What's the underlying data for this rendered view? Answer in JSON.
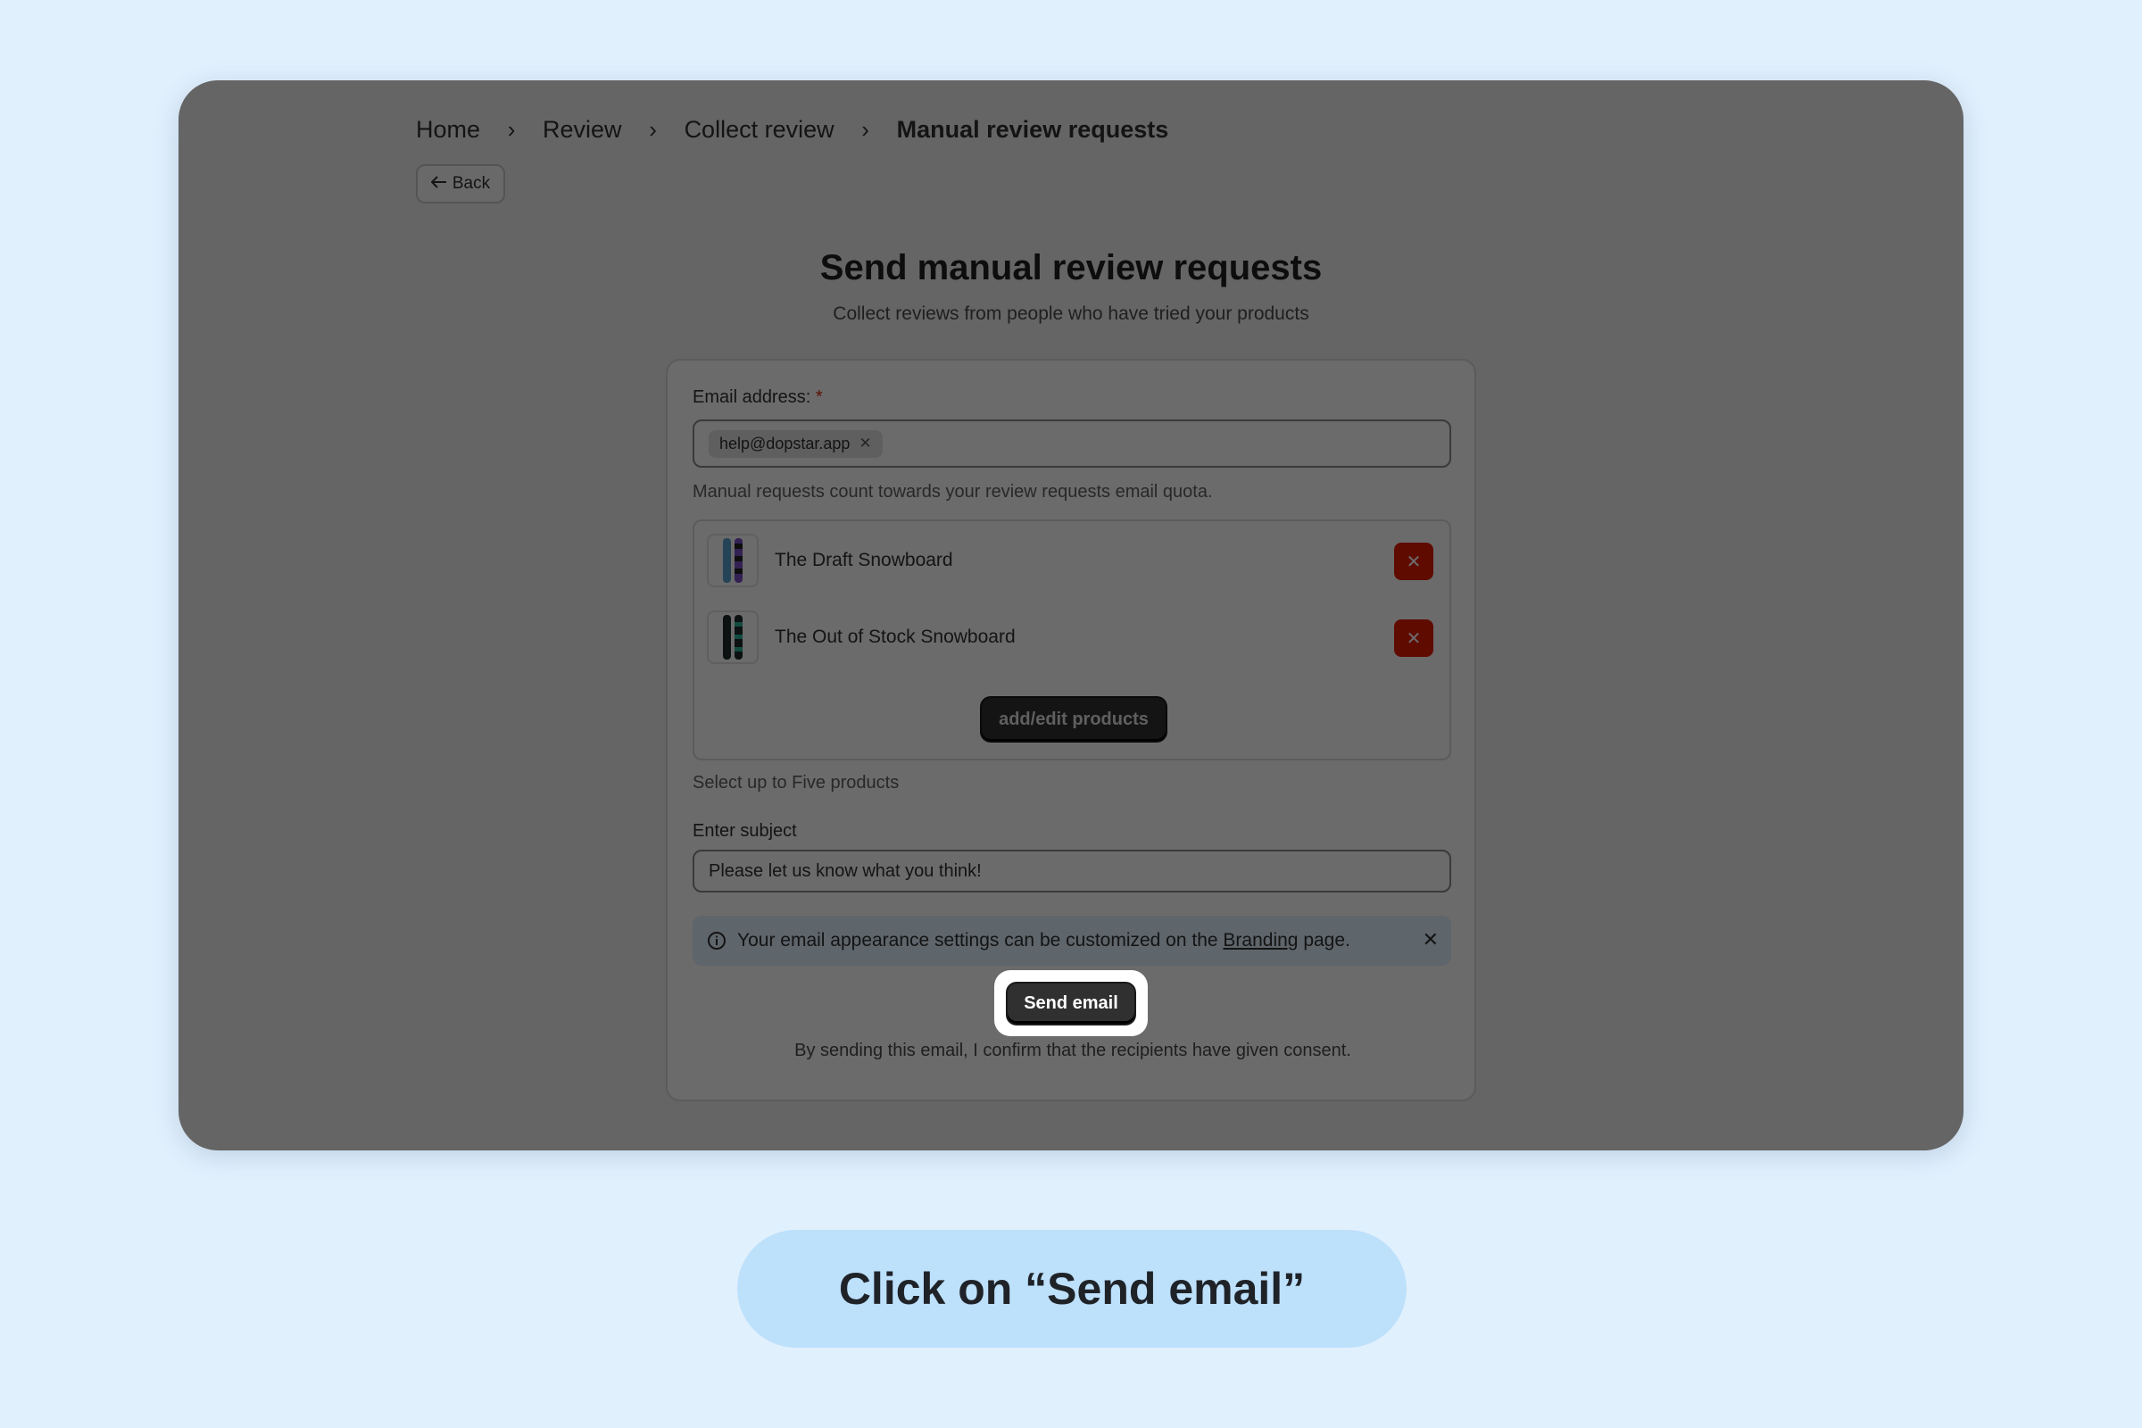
{
  "breadcrumb": {
    "items": [
      "Home",
      "Review",
      "Collect review"
    ],
    "current": "Manual review requests",
    "separator": "›"
  },
  "back_button": {
    "label": "Back"
  },
  "page": {
    "title": "Send manual review requests",
    "subtitle": "Collect reviews from people who have tried your products"
  },
  "form": {
    "email_label": "Email address:",
    "required_mark": "*",
    "email_tag": "help@dopstar.app",
    "email_help": "Manual requests count towards your review requests email quota.",
    "products": [
      {
        "name": "The Draft Snowboard",
        "thumb_colors": [
          "#5a6fd0",
          "#7a4fc8"
        ]
      },
      {
        "name": "The Out of Stock Snowboard",
        "thumb_colors": [
          "#1e2a2a",
          "#2bb39a"
        ]
      }
    ],
    "add_products_label": "add/edit products",
    "products_help": "Select up to Five products",
    "subject_label": "Enter subject",
    "subject_value": "Please let us know what you think!",
    "banner": {
      "text_before": "Your email appearance settings can be customized on the",
      "link": "Branding",
      "text_after": "page."
    },
    "send_label": "Send email",
    "consent": "By sending this email, I confirm that the recipients have given consent."
  },
  "instruction": "Click on “Send email”",
  "colors": {
    "background": "#e1f0fd",
    "instruction_pill": "#bde0fb",
    "remove_button": "#e51c00",
    "primary_button": "#303030"
  }
}
